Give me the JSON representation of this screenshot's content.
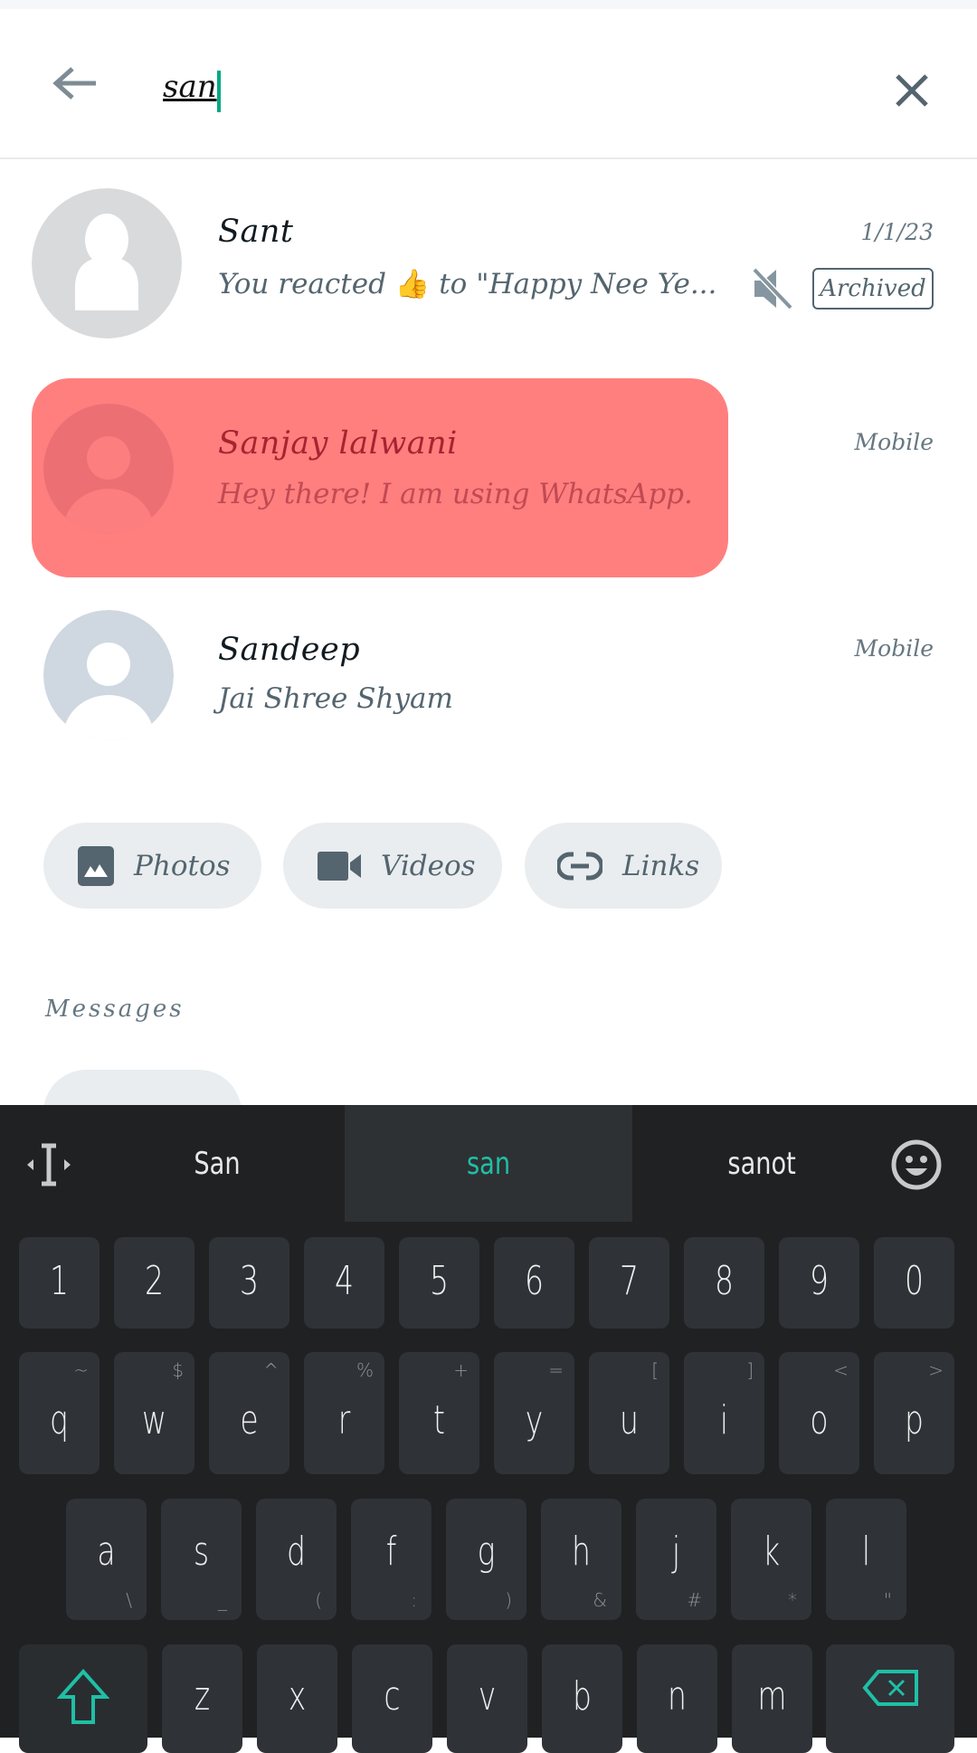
{
  "search": {
    "query": "san"
  },
  "results": [
    {
      "name": "Sant",
      "preview_before": "You reacted ",
      "emoji": "👍",
      "preview_after": " to \"Happy Nee Ye...",
      "time": "1/1/23",
      "muted": true,
      "badge": "Archived"
    },
    {
      "name": "Sanjay lalwani",
      "preview": "Hey there! I am using WhatsApp.",
      "meta": "Mobile",
      "highlight_color": "#ff7f7f"
    },
    {
      "name": "Sandeep",
      "preview": "Jai Shree Shyam",
      "meta": "Mobile"
    }
  ],
  "filters": [
    {
      "label": "Photos",
      "icon": "image-icon"
    },
    {
      "label": "Videos",
      "icon": "video-camera-icon"
    },
    {
      "label": "Links",
      "icon": "link-icon"
    }
  ],
  "sections": {
    "messages": "Messages"
  },
  "keyboard": {
    "suggestions": [
      "San",
      "san",
      "sanot"
    ],
    "accent": "#1fbfa6",
    "number_row": [
      "1",
      "2",
      "3",
      "4",
      "5",
      "6",
      "7",
      "8",
      "9",
      "0"
    ],
    "row1": [
      [
        "q",
        "~"
      ],
      [
        "w",
        "$"
      ],
      [
        "e",
        "^"
      ],
      [
        "r",
        "%"
      ],
      [
        "t",
        "+"
      ],
      [
        "y",
        "="
      ],
      [
        "u",
        "["
      ],
      [
        "i",
        "]"
      ],
      [
        "o",
        "<"
      ],
      [
        "p",
        ">"
      ]
    ],
    "row2": [
      [
        "a",
        "\\"
      ],
      [
        "s",
        "_"
      ],
      [
        "d",
        "("
      ],
      [
        "f",
        ":"
      ],
      [
        "g",
        ")"
      ],
      [
        "h",
        "&"
      ],
      [
        "j",
        "#"
      ],
      [
        "k",
        "*"
      ],
      [
        "l",
        "\""
      ]
    ],
    "row3": [
      "z",
      "x",
      "c",
      "v",
      "b",
      "n",
      "m"
    ]
  }
}
